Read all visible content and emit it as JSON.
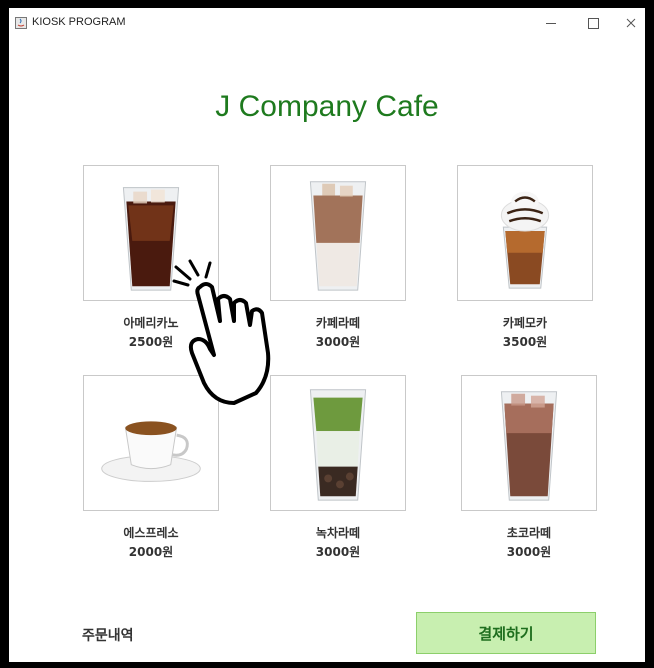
{
  "window": {
    "title": "KIOSK PROGRAM",
    "minimize_label": "−",
    "maximize_label": "□",
    "close_label": "×"
  },
  "header": {
    "title": "J Company Cafe"
  },
  "menu": [
    {
      "name": "아메리카노",
      "price": "2500원",
      "image": "americano-image"
    },
    {
      "name": "카페라떼",
      "price": "3000원",
      "image": "cafe-latte-image"
    },
    {
      "name": "카페모카",
      "price": "3500원",
      "image": "cafe-mocha-image"
    },
    {
      "name": "에스프레소",
      "price": "2000원",
      "image": "espresso-image"
    },
    {
      "name": "녹차라떼",
      "price": "3000원",
      "image": "green-tea-latte-image"
    },
    {
      "name": "초코라떼",
      "price": "3000원",
      "image": "choco-latte-image"
    }
  ],
  "footer": {
    "order_history_label": "주문내역",
    "pay_button_label": "결제하기"
  },
  "colors": {
    "title_green": "#1e7a1e",
    "pay_button_bg": "#c8efb0",
    "pay_button_border": "#8ccf6b"
  }
}
